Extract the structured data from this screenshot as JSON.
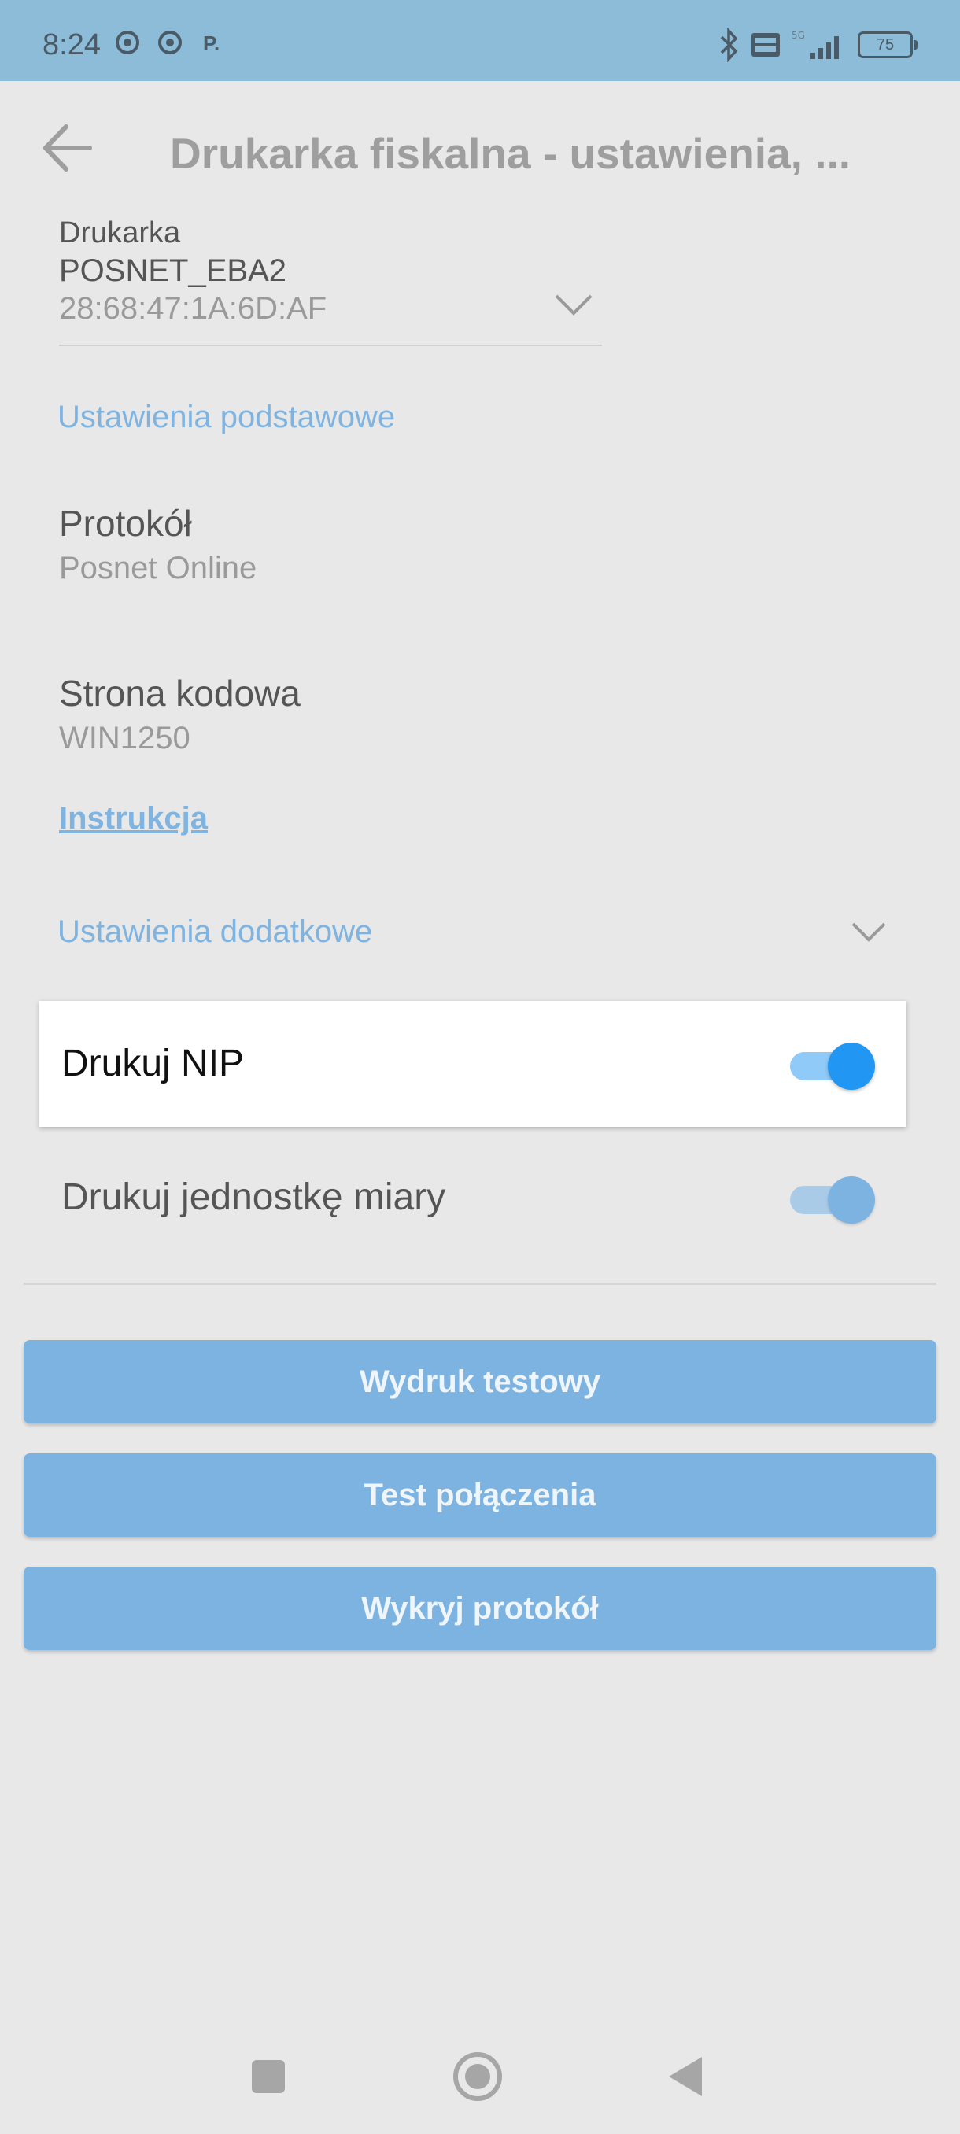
{
  "status_bar": {
    "time": "8:24",
    "notif_text": "P.",
    "battery": "75"
  },
  "app_bar": {
    "title": "Drukarka fiskalna - ustawienia, ..."
  },
  "printer": {
    "label": "Drukarka",
    "name": "POSNET_EBA2",
    "address": "28:68:47:1A:6D:AF"
  },
  "basic_settings": {
    "heading": "Ustawienia podstawowe",
    "protocol": {
      "title": "Protokół",
      "value": "Posnet Online"
    },
    "codepage": {
      "title": "Strona kodowa",
      "value": "WIN1250"
    },
    "instructions_link": "Instrukcja"
  },
  "additional_settings": {
    "heading": "Ustawienia dodatkowe",
    "toggles": [
      {
        "label": "Drukuj NIP",
        "on": true,
        "highlighted": true
      },
      {
        "label": "Drukuj jednostkę miary",
        "on": true,
        "highlighted": false
      }
    ]
  },
  "buttons": {
    "test_print": "Wydruk testowy",
    "test_connection": "Test połączenia",
    "detect_protocol": "Wykryj protokół"
  },
  "colors": {
    "accent": "#7fb3e0",
    "toggle_active": "#2196f3",
    "toggle_track_active": "#90caf9",
    "toggle_dim_thumb": "#7db3e1",
    "toggle_dim_track": "#a9cbe8",
    "button": "#7db3e1",
    "status_bar": "#8cbcd7"
  }
}
